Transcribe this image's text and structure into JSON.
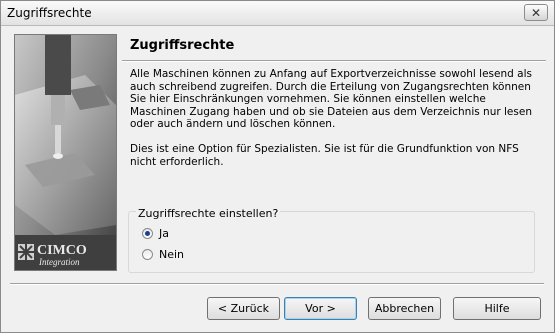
{
  "window": {
    "title": "Zugriffsrechte",
    "close_glyph": "✕"
  },
  "sidebar_art": {
    "logo_top": "CIMCO",
    "logo_bottom": "Integration",
    "icon": "cnc-mill-image"
  },
  "page": {
    "heading": "Zugriffsrechte",
    "paragraph1": "Alle Maschinen können zu Anfang auf Exportverzeichnisse sowohl lesend als auch schreibend zugreifen. Durch die Erteilung von Zugangsrechten können Sie hier Einschränkungen vornehmen. Sie können einstellen welche Maschinen Zugang haben und ob sie Dateien aus dem Verzeichnis nur lesen oder auch ändern und löschen können.",
    "paragraph2": "Dies ist eine Option für Spezialisten. Sie ist für die Grundfunktion von NFS nicht erforderlich."
  },
  "access_group": {
    "label": "Zugriffsrechte einstellen?",
    "options": [
      {
        "label": "Ja",
        "selected": true
      },
      {
        "label": "Nein",
        "selected": false
      }
    ]
  },
  "buttons": {
    "back": "< Zurück",
    "next": "Vor >",
    "cancel": "Abbrechen",
    "help": "Hilfe"
  }
}
